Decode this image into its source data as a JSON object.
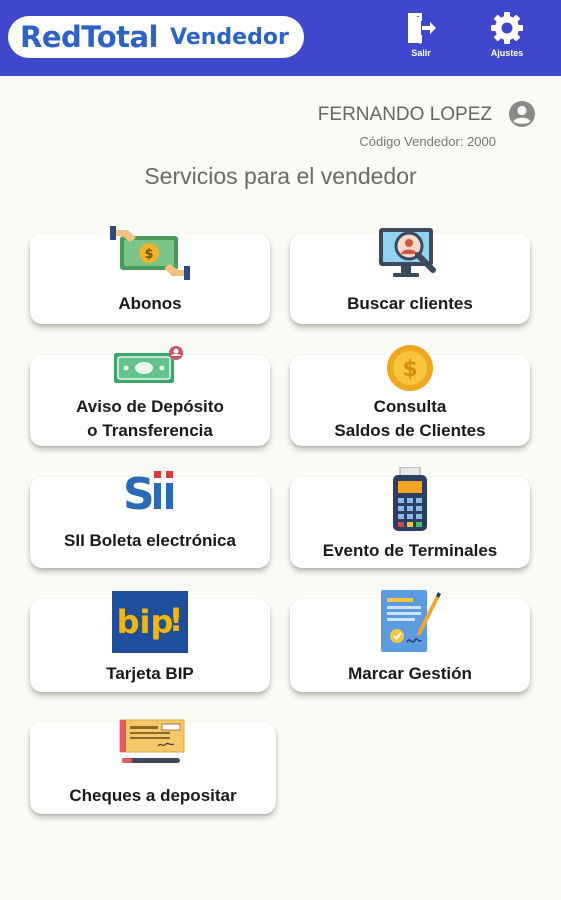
{
  "header": {
    "logo_red": "Red",
    "logo_total": "Total",
    "logo_vendedor": "Vendedor",
    "salir_label": "Salir",
    "ajustes_label": "Ajustes"
  },
  "user": {
    "name": "FERNANDO LOPEZ",
    "code": "Código Vendedor: 2000"
  },
  "section_title": "Servicios para el vendedor",
  "services": [
    {
      "line1": "Abonos",
      "line2": "",
      "icon": "money-exchange-icon"
    },
    {
      "line1": "Buscar clientes",
      "line2": "",
      "icon": "search-client-monitor-icon"
    },
    {
      "line1": "Aviso de Depósito",
      "line2": "o Transferencia",
      "icon": "banknote-transfer-icon"
    },
    {
      "line1": "Consulta",
      "line2": "Saldos de Clientes",
      "icon": "gold-coin-icon"
    },
    {
      "line1": "SII Boleta electrónica",
      "line2": "",
      "icon": "sii-logo-icon"
    },
    {
      "line1": "Evento de Terminales",
      "line2": "",
      "icon": "payment-terminal-icon"
    },
    {
      "line1": "Tarjeta BIP",
      "line2": "",
      "icon": "bip-card-icon"
    },
    {
      "line1": "Marcar Gestión",
      "line2": "",
      "icon": "signed-document-icon"
    },
    {
      "line1": "Cheques a depositar",
      "line2": "",
      "icon": "cheque-icon"
    }
  ],
  "colors": {
    "header_bg": "#3f48cc",
    "page_bg": "#fbfbf5",
    "card_bg": "#ffffff"
  }
}
